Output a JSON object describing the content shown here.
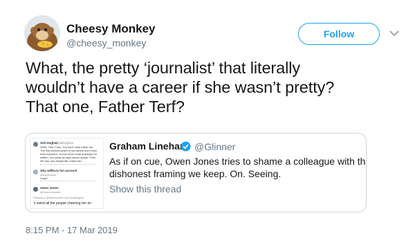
{
  "author": {
    "display_name": "Cheesy Monkey",
    "handle": "@cheesy_monkey",
    "follow_label": "Follow"
  },
  "tweet": {
    "text_lines": [
      "What, the pretty ‘journalist’ that literally",
      "wouldn’t have a career if she wasn’t pretty?",
      "That one, Father Terf?"
    ],
    "timestamp": "8:15 PM - 17 Mar 2019"
  },
  "quoted_tweet": {
    "display_name": "Graham Linehan",
    "handle": "@Glinner",
    "text_lines": [
      "As if on cue, Owen Jones tries to shame a colleague with the same",
      "dishonest framing we keep. On. Seeing."
    ],
    "show_thread_label": "Show this thread",
    "thumbnail": {
      "post1_name": "Sali Hughes",
      "post1_handle": "@salihughes",
      "post1_lines": [
        "What. This. Fuck. You don't even follow me.",
        "The first several years of my tweets don't even",
        "exist anymore. You've never read anything I've",
        "written, not using all-caps about racism. Fuck",
        "off now, you desperate, manic fan"
      ],
      "post2_name": "why willbury fan account",
      "post2_lines": [
        "@salihughes",
        "Legit?"
      ],
      "post3_name": "Owen Jones",
      "post3_handle": "@OwenJones84",
      "post3_reply": "Replying to @nytimesreturn and @salihughes",
      "post3_text": "'s weird all the people cheering her on"
    }
  },
  "colors": {
    "accent": "#1da1f2",
    "text": "#14171a",
    "muted": "#657786",
    "border": "#ccd6dd"
  }
}
